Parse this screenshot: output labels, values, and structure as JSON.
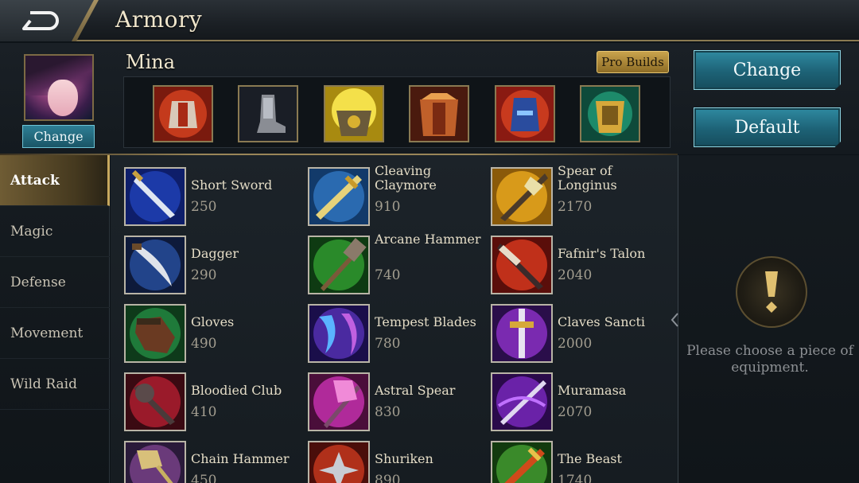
{
  "header": {
    "title": "Armory"
  },
  "hero": {
    "name": "Mina",
    "change_label": "Change"
  },
  "buttons": {
    "pro_builds": "Pro Builds",
    "change": "Change",
    "default": "Default"
  },
  "build_slots": [
    {
      "icon": "red-armor-icon",
      "color": "#c43a1c"
    },
    {
      "icon": "boots-icon",
      "color": "#6d7077"
    },
    {
      "icon": "gold-armor-icon",
      "color": "#d6b227"
    },
    {
      "icon": "chest-armor-icon",
      "color": "#b2522a"
    },
    {
      "icon": "blue-helmet-icon",
      "color": "#2a4c9e"
    },
    {
      "icon": "gold-gauntlet-icon",
      "color": "#1d8a6a"
    }
  ],
  "categories": [
    "Attack",
    "Magic",
    "Defense",
    "Movement",
    "Wild Raid"
  ],
  "active_category": "Attack",
  "items": [
    {
      "name": "Short Sword",
      "price": "250",
      "icon": "short-sword-icon",
      "bg": "#1c3aa8"
    },
    {
      "name": "Cleaving Claymore",
      "price": "910",
      "icon": "claymore-icon",
      "bg": "#2a6ab0"
    },
    {
      "name": "Spear of Longinus",
      "price": "2170",
      "icon": "spear-icon",
      "bg": "#d89a1a"
    },
    {
      "name": "Dagger",
      "price": "290",
      "icon": "dagger-icon",
      "bg": "#22448a"
    },
    {
      "name": "Arcane Hammer",
      "price": "740",
      "icon": "hammer-icon",
      "bg": "#2a8a2a"
    },
    {
      "name": "Fafnir's Talon",
      "price": "2040",
      "icon": "talon-icon",
      "bg": "#c0301a"
    },
    {
      "name": "Gloves",
      "price": "490",
      "icon": "gloves-icon",
      "bg": "#1f7a3a"
    },
    {
      "name": "Tempest Blades",
      "price": "780",
      "icon": "tempest-blades-icon",
      "bg": "#4a2aa0"
    },
    {
      "name": "Claves Sancti",
      "price": "2000",
      "icon": "claves-sancti-icon",
      "bg": "#7a2ab0"
    },
    {
      "name": "Bloodied Club",
      "price": "410",
      "icon": "club-icon",
      "bg": "#9a1a2a"
    },
    {
      "name": "Astral Spear",
      "price": "830",
      "icon": "astral-spear-icon",
      "bg": "#b02a9a"
    },
    {
      "name": "Muramasa",
      "price": "2070",
      "icon": "muramasa-icon",
      "bg": "#6a22a8"
    },
    {
      "name": "Chain Hammer",
      "price": "450",
      "icon": "chain-hammer-icon",
      "bg": "#6a3a7a"
    },
    {
      "name": "Shuriken",
      "price": "890",
      "icon": "shuriken-icon",
      "bg": "#b0301a"
    },
    {
      "name": "The Beast",
      "price": "1740",
      "icon": "beast-icon",
      "bg": "#3a8a2a"
    }
  ],
  "detail": {
    "prompt": "Please choose a piece of equipment."
  }
}
